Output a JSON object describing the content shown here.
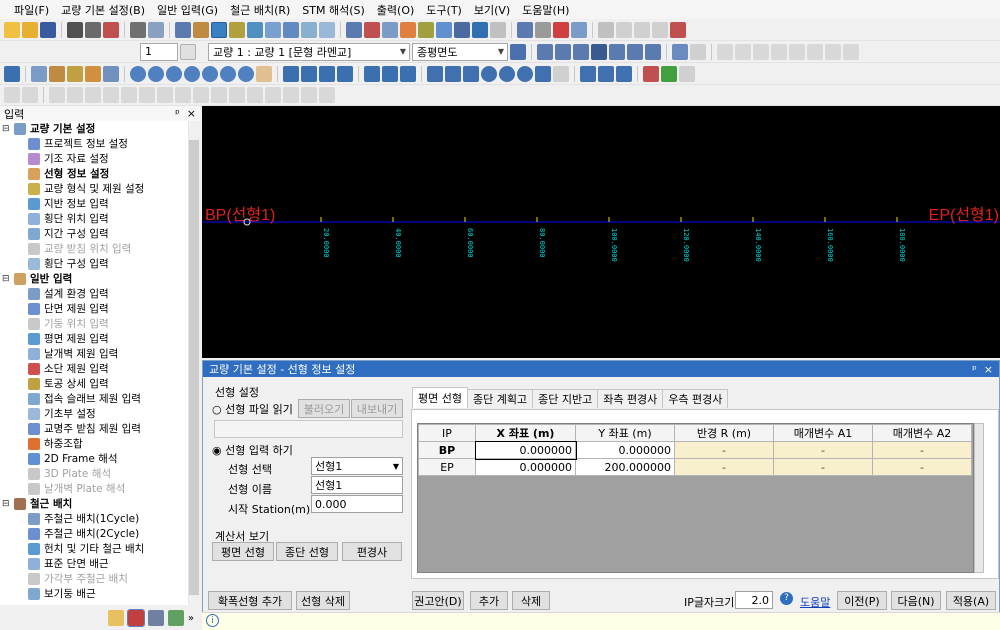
{
  "menu": [
    "파일(F)",
    "교량 기본 설정(B)",
    "일반 입력(G)",
    "철근 배치(R)",
    "STM 해석(S)",
    "출력(O)",
    "도구(T)",
    "보기(V)",
    "도움말(H)"
  ],
  "toolbar": {
    "page_value": "1",
    "bridge_select": "교량 1 : 교량 1 [문형 라멘교]",
    "view_select": "종평면도"
  },
  "colors": {
    "title_blue": "#2e6dbf",
    "canvas_bg": "#000000",
    "alignment_line": "#0000ff",
    "label_red": "#e02020",
    "station_cyan": "#00d8d8",
    "tick_yellow": "#e8e000",
    "cell_yellow": "#f8f0cc"
  },
  "panel": {
    "title": "입력",
    "pin": "ᵖ",
    "close": "×"
  },
  "tree": [
    {
      "label": "교량 기본 설정",
      "level": 0,
      "toggle": "⊟",
      "bold": true,
      "icon": "#7a9cc6"
    },
    {
      "label": "프로젝트 정보 설정",
      "level": 1,
      "icon": "#6e8fcf"
    },
    {
      "label": "기조 자료 설정",
      "level": 1,
      "icon": "#b58ad0"
    },
    {
      "label": "선형 정보 설정",
      "level": 1,
      "icon": "#d9a05a",
      "bold": true
    },
    {
      "label": "교량 형식 및 제원 설정",
      "level": 1,
      "icon": "#c9b04a"
    },
    {
      "label": "지반 정보 입력",
      "level": 1,
      "icon": "#5a9ad0"
    },
    {
      "label": "횡단 위치 입력",
      "level": 1,
      "icon": "#8fb0d8"
    },
    {
      "label": "지간 구성 입력",
      "level": 1,
      "icon": "#7fa8d0"
    },
    {
      "label": "교량 받침 위치 입력",
      "level": 1,
      "icon": "#c8c8c8",
      "dis": true
    },
    {
      "label": "횡단 구성 입력",
      "level": 1,
      "icon": "#9ab8d8"
    },
    {
      "label": "일반 입력",
      "level": 0,
      "toggle": "⊟",
      "bold": true,
      "icon": "#d0a060"
    },
    {
      "label": "설계 환경 입력",
      "level": 1,
      "icon": "#7a9cc6"
    },
    {
      "label": "단면 제원 입력",
      "level": 1,
      "icon": "#6e8fcf"
    },
    {
      "label": "기둥 위치 입력",
      "level": 1,
      "icon": "#c8c8c8",
      "dis": true
    },
    {
      "label": "평면 제원 입력",
      "level": 1,
      "icon": "#5a9ad0"
    },
    {
      "label": "날개벽 제원 입력",
      "level": 1,
      "icon": "#8fb0d8"
    },
    {
      "label": "소단 제원 입력",
      "level": 1,
      "icon": "#d05050"
    },
    {
      "label": "토공 상세 입력",
      "level": 1,
      "icon": "#c0a040"
    },
    {
      "label": "접속 슬래브 제원 입력",
      "level": 1,
      "icon": "#7fa8d0"
    },
    {
      "label": "기초부 설정",
      "level": 1,
      "icon": "#9ab8d8"
    },
    {
      "label": "교명주 받침 제원 입력",
      "level": 1,
      "icon": "#6e8fcf"
    },
    {
      "label": "하중조합",
      "level": 1,
      "icon": "#e07030"
    },
    {
      "label": "2D Frame 해석",
      "level": 1,
      "icon": "#6090d0"
    },
    {
      "label": "3D Plate 해석",
      "level": 1,
      "icon": "#c8c8c8",
      "dis": true
    },
    {
      "label": "날개벽 Plate 해석",
      "level": 1,
      "icon": "#c8c8c8",
      "dis": true
    },
    {
      "label": "철근 배치",
      "level": 0,
      "toggle": "⊟",
      "bold": true,
      "icon": "#a07050"
    },
    {
      "label": "주철근 배치(1Cycle)",
      "level": 1,
      "icon": "#7a9cc6"
    },
    {
      "label": "주철근 배치(2Cycle)",
      "level": 1,
      "icon": "#6e8fcf"
    },
    {
      "label": "헌치 및 기타 철근 배치",
      "level": 1,
      "icon": "#5a9ad0"
    },
    {
      "label": "표준 단면 배근",
      "level": 1,
      "icon": "#8fb0d8"
    },
    {
      "label": "가각부 주철근 배치",
      "level": 1,
      "icon": "#c8c8c8",
      "dis": true
    },
    {
      "label": "보기둥 배근",
      "level": 1,
      "icon": "#7fa8d0"
    }
  ],
  "canvas": {
    "bp_label": "BP(선형1)",
    "ep_label": "EP(선형1)",
    "stations": [
      "20.0000",
      "40.0000",
      "60.0000",
      "80.0000",
      "100.0000",
      "120.0000",
      "140.0000",
      "160.0000",
      "180.0000"
    ],
    "station_values": [
      20,
      40,
      60,
      80,
      100,
      120,
      140,
      160,
      180
    ],
    "total_length": 200
  },
  "dialog": {
    "title": "교량 기본 설정 - 선형 정보 설정",
    "title_pin": "ᵖ",
    "title_close": "×",
    "group_alignment": "선형 설정",
    "radio_file": "선형 파일 읽기",
    "btn_load": "불러오기",
    "btn_export": "내보내기",
    "radio_input": "선형 입력 하기",
    "lbl_select": "선형 선택",
    "select_value": "선형1",
    "lbl_name": "선형 이름",
    "name_value": "선형1",
    "lbl_station": "시작 Station(m)",
    "station_value": "0.000",
    "group_report": "계산서 보기",
    "btn_plan": "평면 선형",
    "btn_profile": "종단 선형",
    "btn_cant": "편경사",
    "tabs": [
      "평면 선형",
      "종단 계획고",
      "종단 지반고",
      "좌측 편경사",
      "우측 편경사"
    ],
    "table_headers": [
      "IP",
      "X 좌표 (m)",
      "Y 좌표 (m)",
      "반경 R (m)",
      "매개변수 A1",
      "매개변수 A2"
    ],
    "table_rows": [
      [
        "BP",
        "0.000000",
        "0.000000",
        "-",
        "-",
        "-"
      ],
      [
        "EP",
        "0.000000",
        "200.000000",
        "-",
        "-",
        "-"
      ]
    ],
    "btn_add_widen": "확폭선형 추가",
    "btn_delete_align": "선형 삭제",
    "btn_recommend": "권고안(D)",
    "btn_add": "추가",
    "btn_delete": "삭제",
    "lbl_ip_font": "IP글자크기",
    "ip_font_value": "2.0",
    "help_link": "도움말",
    "btn_prev": "이전(P)",
    "btn_next": "다음(N)",
    "btn_apply": "적용(A)"
  }
}
